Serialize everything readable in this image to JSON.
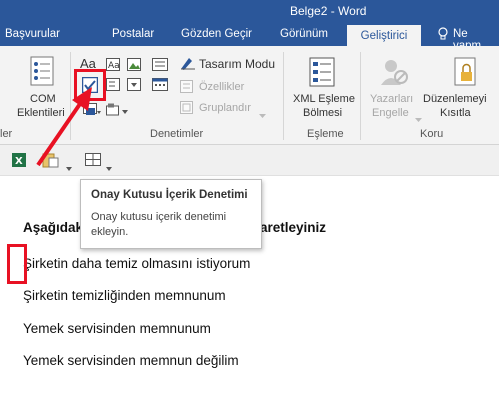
{
  "window": {
    "title": "Belge2 - Word"
  },
  "tabs": [
    {
      "label": "Başvurular"
    },
    {
      "label": "Postalar"
    },
    {
      "label": "Gözden Geçir"
    },
    {
      "label": "Görünüm"
    },
    {
      "label": "Geliştirici",
      "active": true
    }
  ],
  "tell_me": {
    "label": "Ne yapm"
  },
  "ribbon": {
    "addins": {
      "com_label_1": "COM",
      "com_label_2": "Eklentileri",
      "group_label": "ler"
    },
    "controls": {
      "design_mode": "Tasarım Modu",
      "properties": "Özellikler",
      "group": "Gruplandır",
      "group_label": "Denetimler"
    },
    "mapping": {
      "xml_label_1": "XML Eşleme",
      "xml_label_2": "Bölmesi",
      "group_label": "Eşleme"
    },
    "protect": {
      "block_authors_1": "Yazarları",
      "block_authors_2": "Engelle",
      "restrict_1": "Düzenlemeyi",
      "restrict_2": "Kısıtla",
      "group_label": "Koru"
    },
    "text_icon": "Aa"
  },
  "tooltip": {
    "title": "Onay Kutusu İçerik Denetimi",
    "description": "Onay kutusu içerik denetimi ekleyin."
  },
  "document": {
    "heading_left": "Aşağıdak",
    "heading_right": "aretleyiniz",
    "options": [
      "Şirketin daha temiz olmasını istiyorum",
      "Şirketin temizliğinden memnunum",
      "Yemek servisinden memnunum",
      "Yemek servisinden memnun değilim"
    ]
  },
  "colors": {
    "accent": "#2b579a",
    "highlight": "#e81123"
  }
}
